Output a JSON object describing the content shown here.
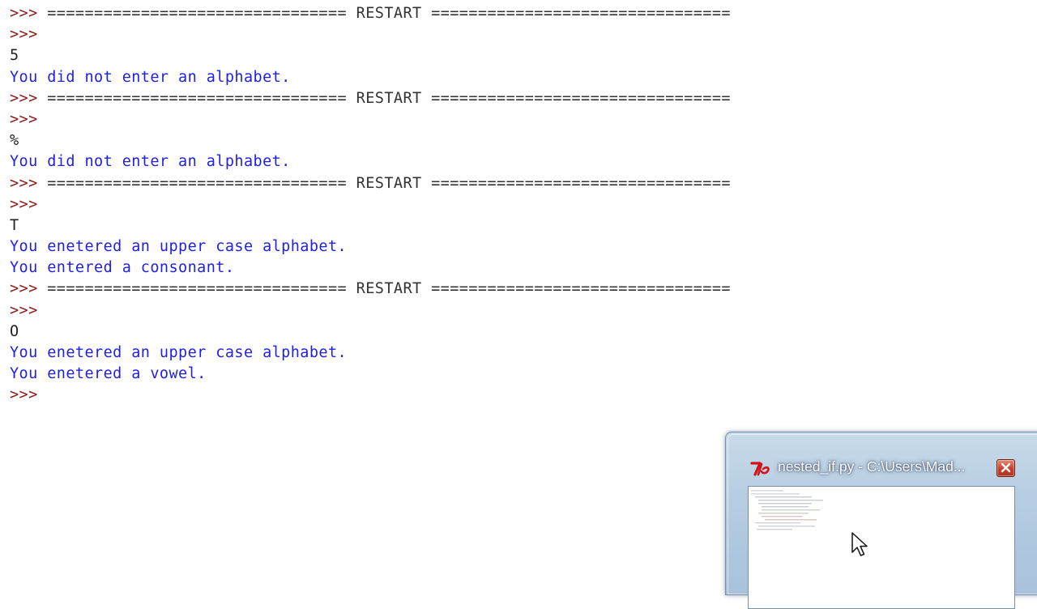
{
  "console": {
    "lines": [
      {
        "kind": "restart",
        "prompt": ">>>",
        "text": " ================================ RESTART ================================"
      },
      {
        "kind": "prompt",
        "prompt": ">>>",
        "text": ""
      },
      {
        "kind": "input",
        "prompt": "",
        "text": "5"
      },
      {
        "kind": "output",
        "prompt": "",
        "text": "You did not enter an alphabet."
      },
      {
        "kind": "restart",
        "prompt": ">>>",
        "text": " ================================ RESTART ================================"
      },
      {
        "kind": "prompt",
        "prompt": ">>>",
        "text": ""
      },
      {
        "kind": "input",
        "prompt": "",
        "text": "%"
      },
      {
        "kind": "output",
        "prompt": "",
        "text": "You did not enter an alphabet."
      },
      {
        "kind": "restart",
        "prompt": ">>>",
        "text": " ================================ RESTART ================================"
      },
      {
        "kind": "prompt",
        "prompt": ">>>",
        "text": ""
      },
      {
        "kind": "input",
        "prompt": "",
        "text": "T"
      },
      {
        "kind": "output",
        "prompt": "",
        "text": "You enetered an upper case alphabet."
      },
      {
        "kind": "output",
        "prompt": "",
        "text": "You entered a consonant."
      },
      {
        "kind": "restart",
        "prompt": ">>>",
        "text": " ================================ RESTART ================================"
      },
      {
        "kind": "prompt",
        "prompt": ">>>",
        "text": ""
      },
      {
        "kind": "input",
        "prompt": "",
        "text": "O"
      },
      {
        "kind": "output",
        "prompt": "",
        "text": "You enetered an upper case alphabet."
      },
      {
        "kind": "output",
        "prompt": "",
        "text": "You enetered a vowel."
      },
      {
        "kind": "prompt",
        "prompt": ">>>",
        "text": ""
      }
    ]
  },
  "thumbnail": {
    "title": "nested_if.py - C:\\Users\\Mad...",
    "app_icon": "python-idle-icon",
    "close_icon": "close-icon"
  },
  "colors": {
    "prompt": "#8b1c1c",
    "output": "#1f1fe8",
    "input": "#222222",
    "background": "#ffffff"
  }
}
